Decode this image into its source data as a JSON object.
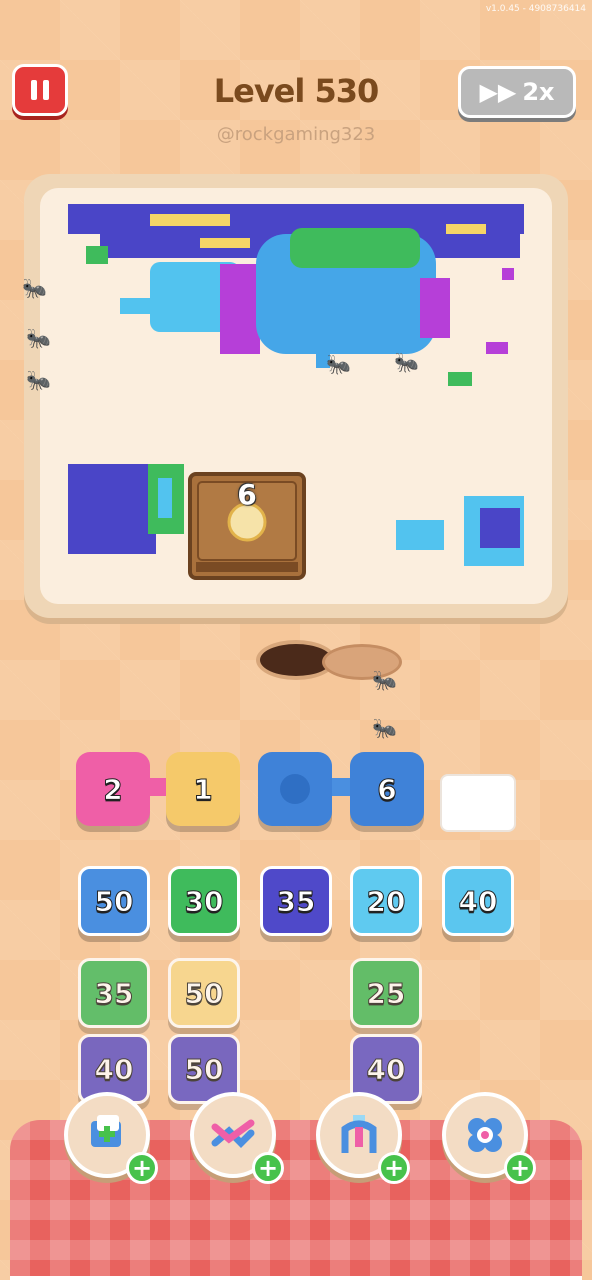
{
  "version": "v1.0.45 - 4908736414",
  "header": {
    "level": "Level 530",
    "username": "@rockgaming323",
    "speed": "2x"
  },
  "chest": {
    "count": "6"
  },
  "queue": [
    {
      "value": "2",
      "color": "#ef5fa7"
    },
    {
      "value": "1",
      "color": "#f5c96a"
    },
    {
      "value": "",
      "color": "#3f82d8"
    },
    {
      "value": "6",
      "color": "#3f82d8"
    }
  ],
  "columns": [
    {
      "tiles": [
        {
          "value": "50",
          "color": "#4a8fe0"
        },
        {
          "value": "35",
          "color": "#3fbb5c"
        },
        {
          "value": "40",
          "color": "#5a50c8"
        }
      ]
    },
    {
      "tiles": [
        {
          "value": "30",
          "color": "#3fbb5c"
        },
        {
          "value": "50",
          "color": "#f7d98a"
        },
        {
          "value": "50",
          "color": "#5a50c8"
        }
      ]
    },
    {
      "tiles": [
        {
          "value": "35",
          "color": "#4f49c9"
        }
      ]
    },
    {
      "tiles": [
        {
          "value": "20",
          "color": "#5fcaf0"
        },
        {
          "value": "25",
          "color": "#3fbb5c"
        },
        {
          "value": "40",
          "color": "#5a50c8"
        }
      ]
    },
    {
      "tiles": [
        {
          "value": "40",
          "color": "#5bc6ef"
        }
      ]
    }
  ],
  "powerups": [
    "add-slot-icon",
    "shuffle-icon",
    "magnet-claw-icon",
    "flower-icon"
  ]
}
